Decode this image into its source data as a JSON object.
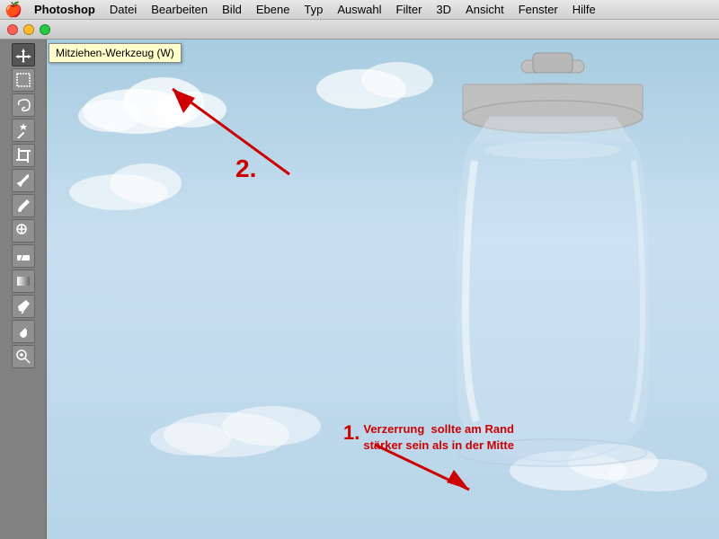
{
  "menubar": {
    "apple": "🍎",
    "items": [
      "Photoshop",
      "Datei",
      "Bearbeiten",
      "Bild",
      "Ebene",
      "Typ",
      "Auswahl",
      "Filter",
      "3D",
      "Ansicht",
      "Fenster",
      "Hilfe"
    ]
  },
  "window": {
    "traffic_lights": [
      "close",
      "minimize",
      "maximize"
    ]
  },
  "toolbar": {
    "tools": [
      {
        "name": "move",
        "icon": "move"
      },
      {
        "name": "marquee",
        "icon": "marquee"
      },
      {
        "name": "lasso",
        "icon": "lasso"
      },
      {
        "name": "magic-wand",
        "icon": "wand"
      },
      {
        "name": "crop",
        "icon": "crop"
      },
      {
        "name": "eyedropper",
        "icon": "eyedropper"
      },
      {
        "name": "brush",
        "icon": "brush"
      },
      {
        "name": "clone",
        "icon": "clone"
      },
      {
        "name": "eraser",
        "icon": "eraser"
      },
      {
        "name": "gradient",
        "icon": "gradient"
      },
      {
        "name": "pen",
        "icon": "pen"
      },
      {
        "name": "hand",
        "icon": "hand"
      },
      {
        "name": "zoom",
        "icon": "zoom"
      }
    ],
    "selected_tool": "move",
    "tooltip": "Mitziehen-Werkzeug (W)"
  },
  "annotations": {
    "item1": {
      "number": "1.",
      "text": "Verzerrung  sollte am Rand\nstärker sein als in der Mitte"
    },
    "item2": {
      "number": "2."
    }
  },
  "colors": {
    "annotation_red": "#cc0000",
    "sky_top": "#a8cce0",
    "sky_bottom": "#b8d4e8"
  }
}
